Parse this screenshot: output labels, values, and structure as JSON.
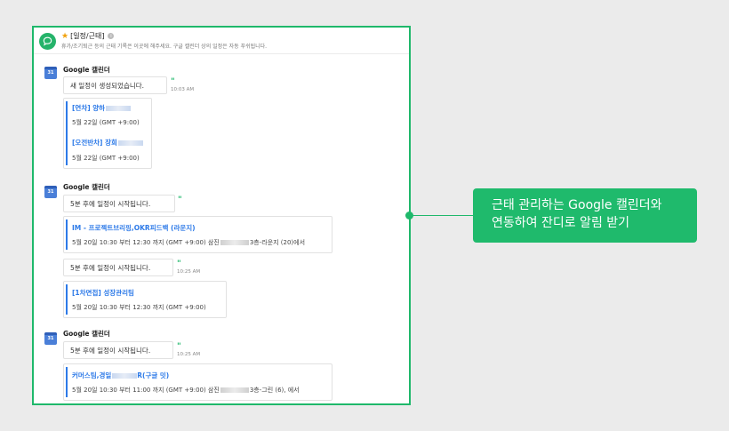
{
  "channel": {
    "title": "[일정/근태]",
    "description": "휴가/조기퇴근 등의 근태 기록은 이곳에 해주세요. 구글 캘린더 상의 일정은 자동 푸쉬됩니다."
  },
  "sender_name": "Google 캘린더",
  "groups": [
    {
      "message": "새 일정이 생성되었습니다.",
      "time": "10:03 AM",
      "events": [
        {
          "title": "[연차] 양하",
          "meta": "5월 22일 (GMT +9:00)"
        },
        {
          "title": "[오전반차] 장희",
          "meta": "5월 22일 (GMT +9:00)"
        }
      ]
    },
    {
      "message": "5분 후에 일정이 시작됩니다.",
      "events": [
        {
          "title": "IM - 프로젝트브리핑,OKR피드백 (라운지)",
          "meta_a": "5월 20일 10:30 부터 12:30 까지 (GMT +9:00) 삼진",
          "meta_b": "3층-라운지 (20)에서"
        }
      ],
      "message2": "5분 후에 일정이 시작됩니다.",
      "time2": "10:25 AM",
      "events2": [
        {
          "title": "[1차면접] 성장관리팀",
          "meta": "5월 20일 10:30 부터 12:30 까지 (GMT +9:00)"
        }
      ]
    },
    {
      "message": "5분 후에 일정이 시작됩니다.",
      "time": "10:25 AM",
      "events": [
        {
          "title_a": "커머스팀,경일",
          "title_b": "R(구글 밋)",
          "meta_a": "5월 20일 10:30 부터 11:00 까지 (GMT +9:00) 삼진",
          "meta_b": "3층-그린 (6), 에서"
        }
      ]
    }
  ],
  "callout": {
    "line1": "근태 관리하는 Google 캘린더와",
    "line2": "연동하여 잔디로 알림 받기"
  },
  "colors": {
    "accent": "#1fb86b",
    "link": "#2d7ae8"
  },
  "icons": {
    "channel": "chat-bubble-icon",
    "sender": "google-calendar-icon",
    "quote": "quote-icon"
  }
}
